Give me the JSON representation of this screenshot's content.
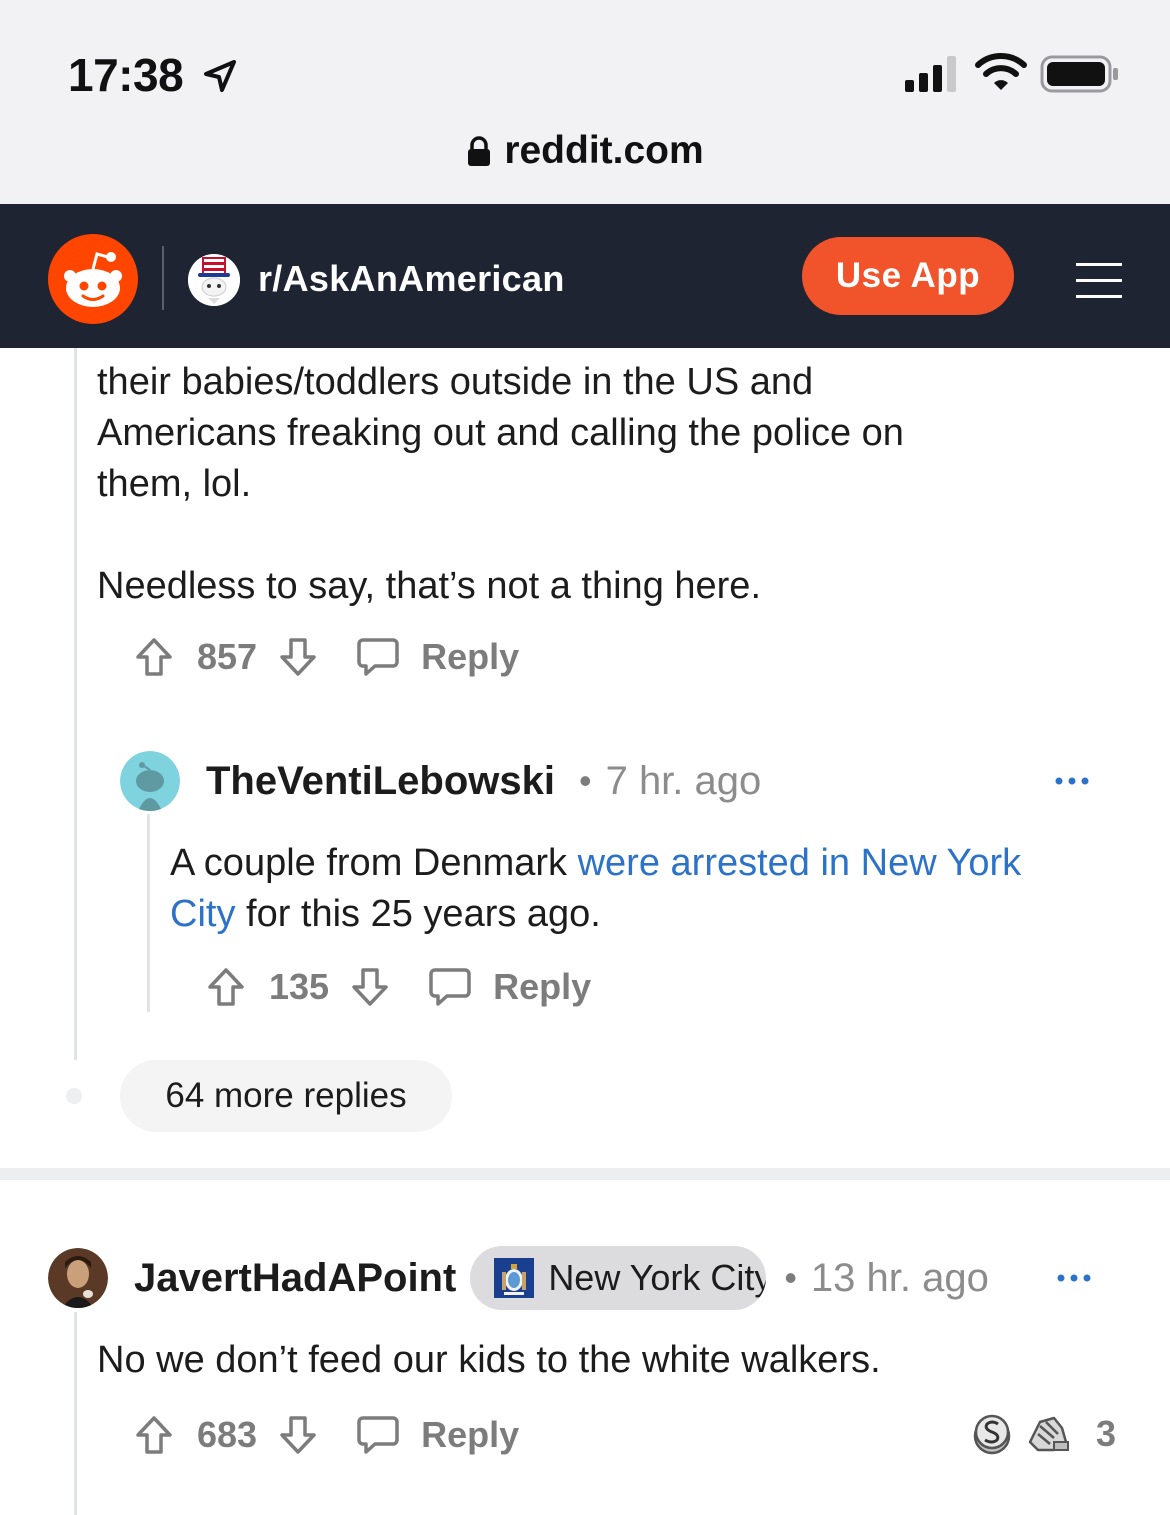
{
  "status_bar": {
    "time": "17:38"
  },
  "browser": {
    "url": "reddit.com"
  },
  "header": {
    "subreddit": "r/AskAnAmerican",
    "use_app_label": "Use App"
  },
  "comment1": {
    "text_lines": [
      "their babies/toddlers outside in the US and",
      "Americans freaking out and calling the police on",
      "them, lol."
    ],
    "text_extra": "Needless to say, that’s not a thing here.",
    "score": "857",
    "reply_label": "Reply"
  },
  "comment2": {
    "author": "TheVentiLebowski",
    "separator": "•",
    "time": "7 hr. ago",
    "text_before": "A couple from Denmark ",
    "link_text": "were arrested in New York City",
    "text_after": " for this 25 years ago.",
    "score": "135",
    "reply_label": "Reply"
  },
  "more_replies": "64 more replies",
  "comment3": {
    "author": "JavertHadAPoint",
    "flair": "New York City",
    "separator": "•",
    "time": "13 hr. ago",
    "text": "No we don’t feed our kids to the white walkers.",
    "score": "683",
    "reply_label": "Reply",
    "award_count": "3"
  },
  "colors": {
    "reddit_orange": "#f1532a",
    "header_bg": "#1f2433",
    "link": "#2d72c9"
  }
}
